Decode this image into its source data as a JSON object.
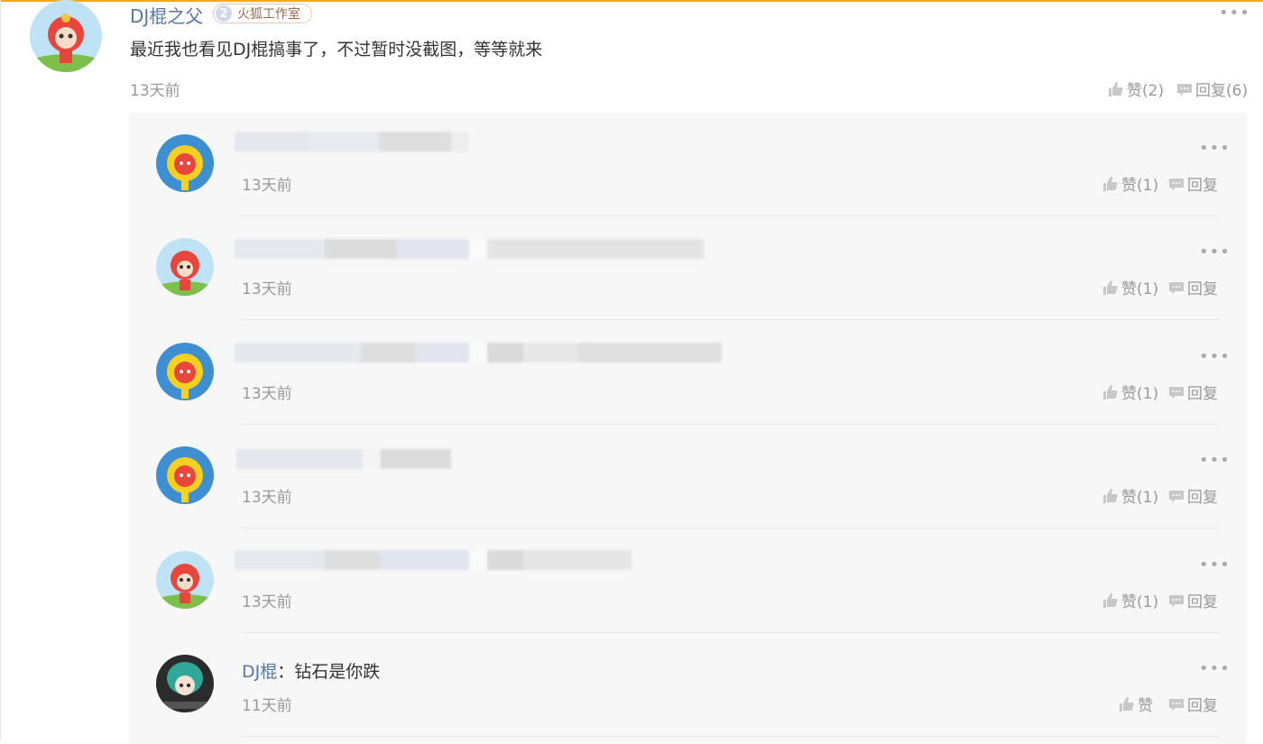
{
  "main_comment": {
    "username": "DJ棍之父",
    "badge_level": "2",
    "badge_label": "火狐工作室",
    "text": "最近我也看见DJ棍搞事了，不过暂时没截图，等等就来",
    "time": "13天前",
    "like_label": "赞(2)",
    "reply_label": "回复(6)",
    "more": "•••"
  },
  "replies": [
    {
      "time": "13天前",
      "like_label": "赞(1)",
      "reply_label": "回复",
      "more": "•••"
    },
    {
      "time": "13天前",
      "like_label": "赞(1)",
      "reply_label": "回复",
      "more": "•••"
    },
    {
      "time": "13天前",
      "like_label": "赞(1)",
      "reply_label": "回复",
      "more": "•••"
    },
    {
      "time": "13天前",
      "like_label": "赞(1)",
      "reply_label": "回复",
      "more": "•••"
    },
    {
      "time": "13天前",
      "like_label": "赞(1)",
      "reply_label": "回复",
      "more": "•••"
    },
    {
      "name": "DJ棍",
      "separator": "：",
      "text": "钻石是你跌",
      "time": "11天前",
      "like_label": "赞",
      "reply_label": "回复",
      "more": "•••"
    }
  ],
  "icons": [
    "thumbs-up-icon",
    "reply-bubble-icon",
    "more-icon"
  ],
  "colors": {
    "accent": "#f5a623",
    "username": "#5777a8",
    "muted": "#999999"
  }
}
